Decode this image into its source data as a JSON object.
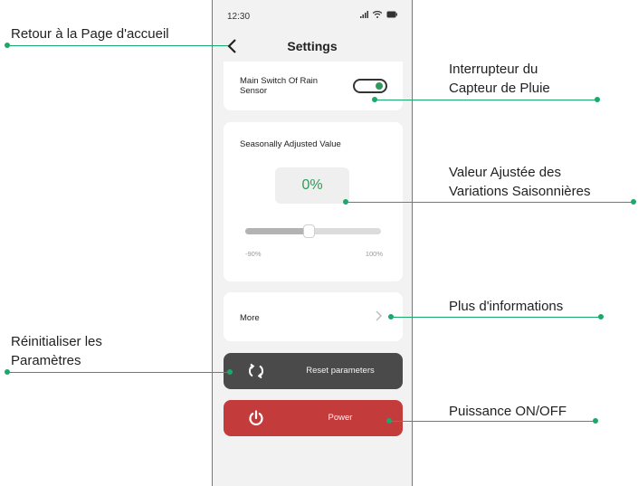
{
  "status_bar": {
    "time": "12:30"
  },
  "header": {
    "title": "Settings"
  },
  "rain_sensor": {
    "label": "Main Switch Of Rain Sensor",
    "enabled": true
  },
  "seasonal": {
    "title": "Seasonally Adjusted Value",
    "value": "0%",
    "slider_min": "-90%",
    "slider_max": "100%",
    "slider_position_fraction": 0.47
  },
  "more": {
    "label": "More"
  },
  "reset": {
    "label": "Reset parameters"
  },
  "power": {
    "label": "Power"
  },
  "annotations": {
    "home": "Retour à la Page d'accueil",
    "rain_switch_line1": "Interrupteur du",
    "rain_switch_line2": "Capteur de Pluie",
    "seasonal_line1": "Valeur Ajustée des",
    "seasonal_line2": "Variations Saisonnières",
    "more_info": "Plus d'informations",
    "reset_line1": "Réinitialiser les",
    "reset_line2": "Paramètres",
    "power": "Puissance ON/OFF"
  },
  "colors": {
    "accent_green": "#2e9a5a",
    "reset_button": "#4a4a4a",
    "power_button": "#c43b3c",
    "callout_line": "#1aa86b"
  }
}
